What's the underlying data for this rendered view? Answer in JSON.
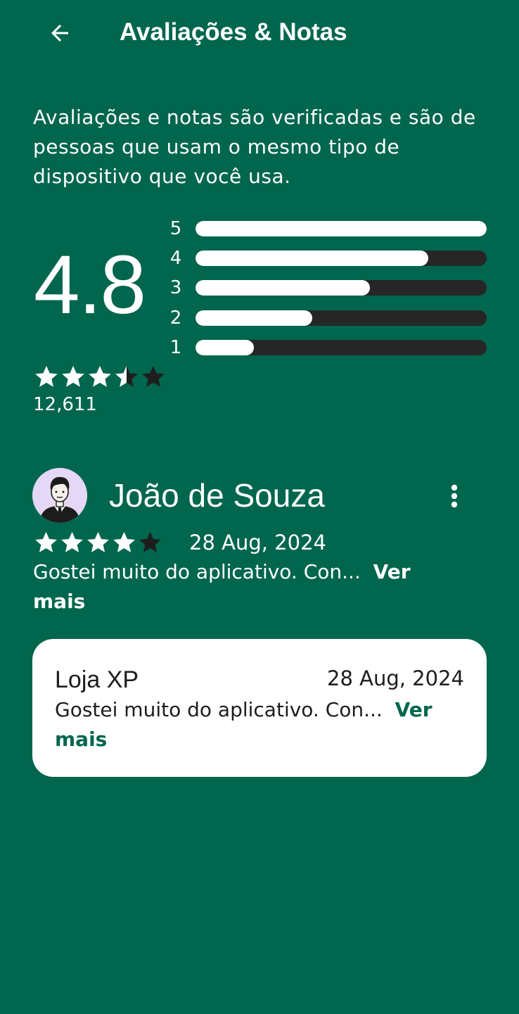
{
  "header": {
    "title": "Avaliações & Notas",
    "back_icon": "arrow-left-icon"
  },
  "summary": {
    "intro": "Avaliações e notas são verificadas e são de pessoas que usam o mesmo tipo de dispositivo que você usa.",
    "average": "4.8",
    "stars_filled": 3.5,
    "stars_total": 5,
    "count": "12,611",
    "distribution": [
      {
        "label": "5",
        "fraction": 1.0
      },
      {
        "label": "4",
        "fraction": 0.8
      },
      {
        "label": "3",
        "fraction": 0.6
      },
      {
        "label": "2",
        "fraction": 0.4
      },
      {
        "label": "1",
        "fraction": 0.2
      }
    ]
  },
  "review": {
    "author": "João de Souza",
    "avatar_icon": "avatar-man-in-suit-icon",
    "menu_icon": "more-vertical-icon",
    "stars_filled": 4,
    "stars_total": 5,
    "date": "28 Aug, 2024",
    "text": "Gostei muito do aplicativo. Con...",
    "see_more": "Ver mais"
  },
  "reply": {
    "author": "Loja XP",
    "date": "28 Aug, 2024",
    "text": "Gostei muito do aplicativo. Con...",
    "see_more": "Ver mais"
  },
  "colors": {
    "background": "#00664e",
    "track": "#262626",
    "card": "#ffffff",
    "accent": "#00664e",
    "text_on_card": "#1d1d1d"
  }
}
